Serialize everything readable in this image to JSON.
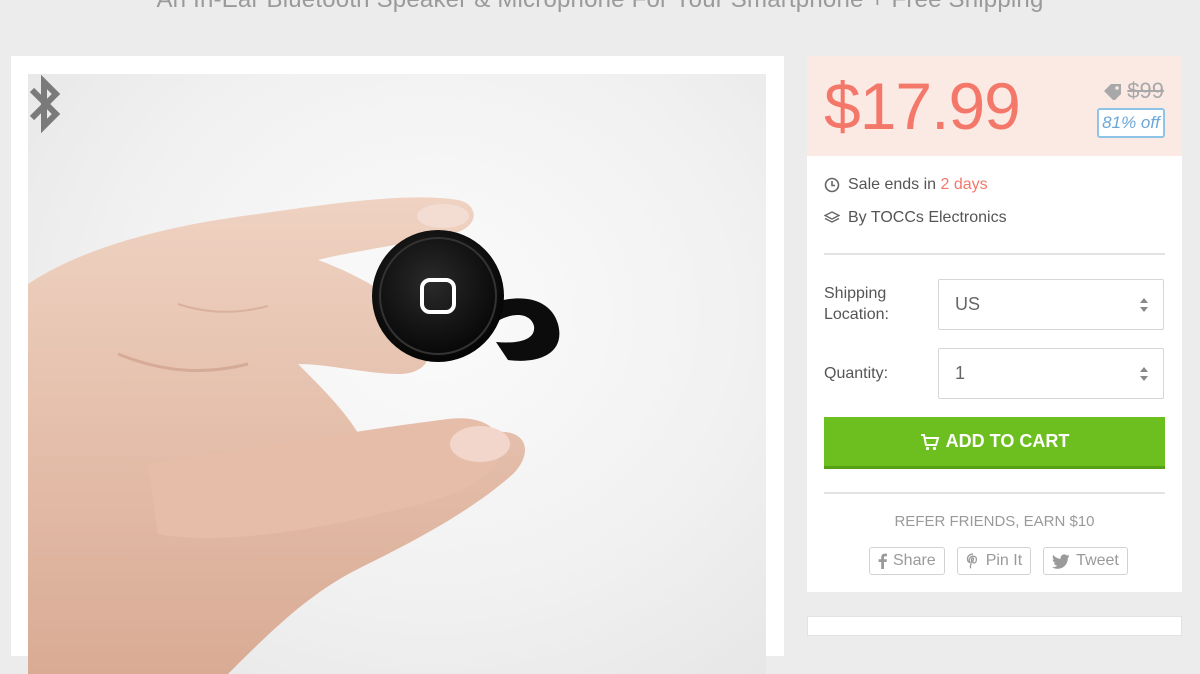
{
  "header": {
    "subtitle": "An In-Ear Bluetooth Speaker & Microphone For Your Smartphone + Free Shipping"
  },
  "product_image": {
    "alt_icon": "bluetooth-icon"
  },
  "pricing": {
    "price": "$17.99",
    "original_price": "$99",
    "discount": "81% off"
  },
  "info": {
    "sale_prefix": "Sale ends in ",
    "sale_days": "2 days",
    "vendor": "By TOCCs Electronics"
  },
  "form": {
    "shipping_label_line1": "Shipping",
    "shipping_label_line2": "Location:",
    "shipping_value": "US",
    "quantity_label": "Quantity:",
    "quantity_value": "1"
  },
  "cart": {
    "button_label": "ADD TO CART"
  },
  "social": {
    "refer_text": "REFER FRIENDS, EARN $10",
    "share_label": "Share",
    "pin_label": "Pin It",
    "tweet_label": "Tweet"
  },
  "colors": {
    "price": "#f4786a",
    "cart_button": "#6cbf1f",
    "discount_border": "#8ec4e8"
  }
}
